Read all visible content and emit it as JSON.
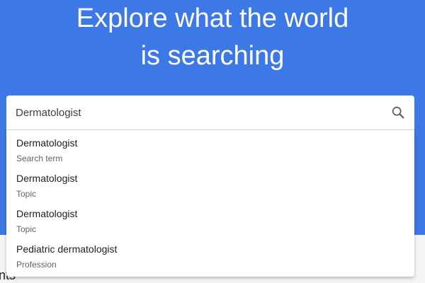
{
  "hero": {
    "headline_line1": "Explore what the world",
    "headline_line2": "is searching"
  },
  "search": {
    "value": "Dermatologist",
    "icon": "search-icon"
  },
  "suggestions": [
    {
      "title": "Dermatologist",
      "type": "Search term"
    },
    {
      "title": "Dermatologist",
      "type": "Topic"
    },
    {
      "title": "Dermatologist",
      "type": "Topic"
    },
    {
      "title": "Pediatric dermatologist",
      "type": "Profession"
    }
  ],
  "background_text": "nts",
  "colors": {
    "hero_bg": "#3c78e6",
    "text_primary": "#202124",
    "text_secondary": "#5f6368"
  }
}
